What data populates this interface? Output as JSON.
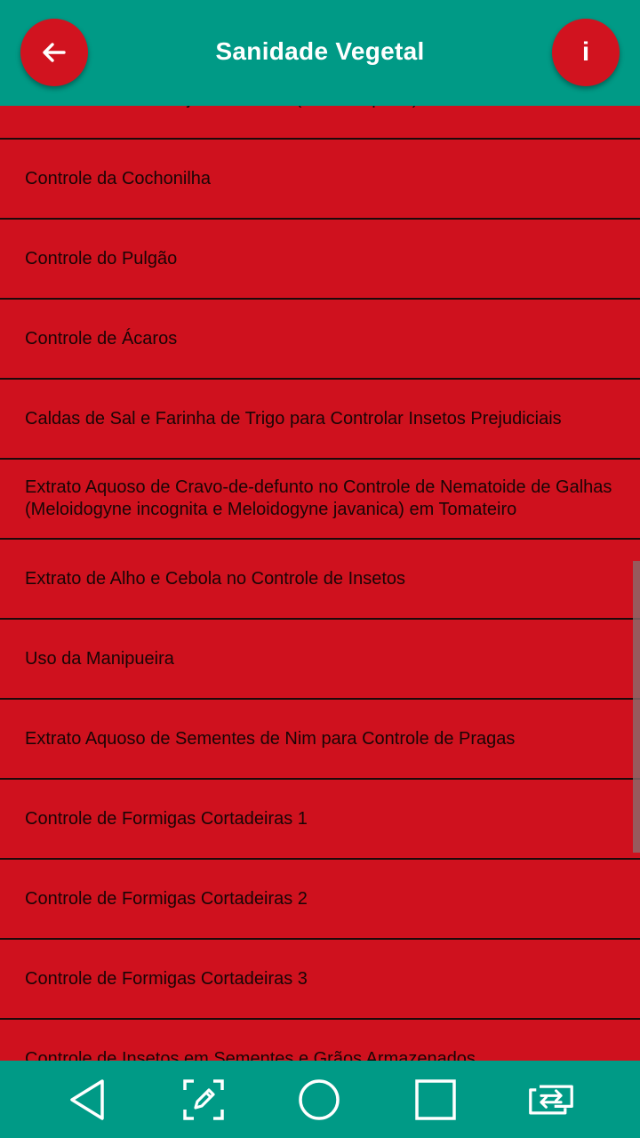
{
  "app": {
    "title": "Sanidade Vegetal",
    "info_label": "i"
  },
  "list": {
    "items": [
      {
        "label": "Controle do Percevejo-do-Tomate (Pintinha-preta)"
      },
      {
        "label": "Controle da Cochonilha"
      },
      {
        "label": "Controle do Pulgão"
      },
      {
        "label": "Controle de Ácaros"
      },
      {
        "label": "Caldas de Sal e Farinha de Trigo para Controlar Insetos Prejudiciais"
      },
      {
        "label": "Extrato Aquoso de Cravo-de-defunto no Controle de Nematoide de Galhas (Meloidogyne incognita e Meloidogyne javanica) em Tomateiro"
      },
      {
        "label": "Extrato de Alho e Cebola no Controle de Insetos"
      },
      {
        "label": "Uso da Manipueira"
      },
      {
        "label": "Extrato Aquoso de Sementes de Nim para Controle de Pragas"
      },
      {
        "label": "Controle de Formigas Cortadeiras 1"
      },
      {
        "label": "Controle de Formigas Cortadeiras 2"
      },
      {
        "label": "Controle de Formigas Cortadeiras 3"
      },
      {
        "label": "Controle de Insetos em Sementes e Grãos Armazenados"
      }
    ]
  },
  "icons": {
    "back": "arrow-left-icon",
    "info": "info-icon",
    "nav_back": "triangle-back-icon",
    "nav_edit": "screenshot-edit-icon",
    "nav_home": "circle-home-icon",
    "nav_recents": "square-recents-icon",
    "nav_switch": "switch-app-icon"
  },
  "colors": {
    "primary": "#009a86",
    "accent": "#cf111e",
    "text": "#1a0505",
    "on_primary": "#ffffff"
  }
}
